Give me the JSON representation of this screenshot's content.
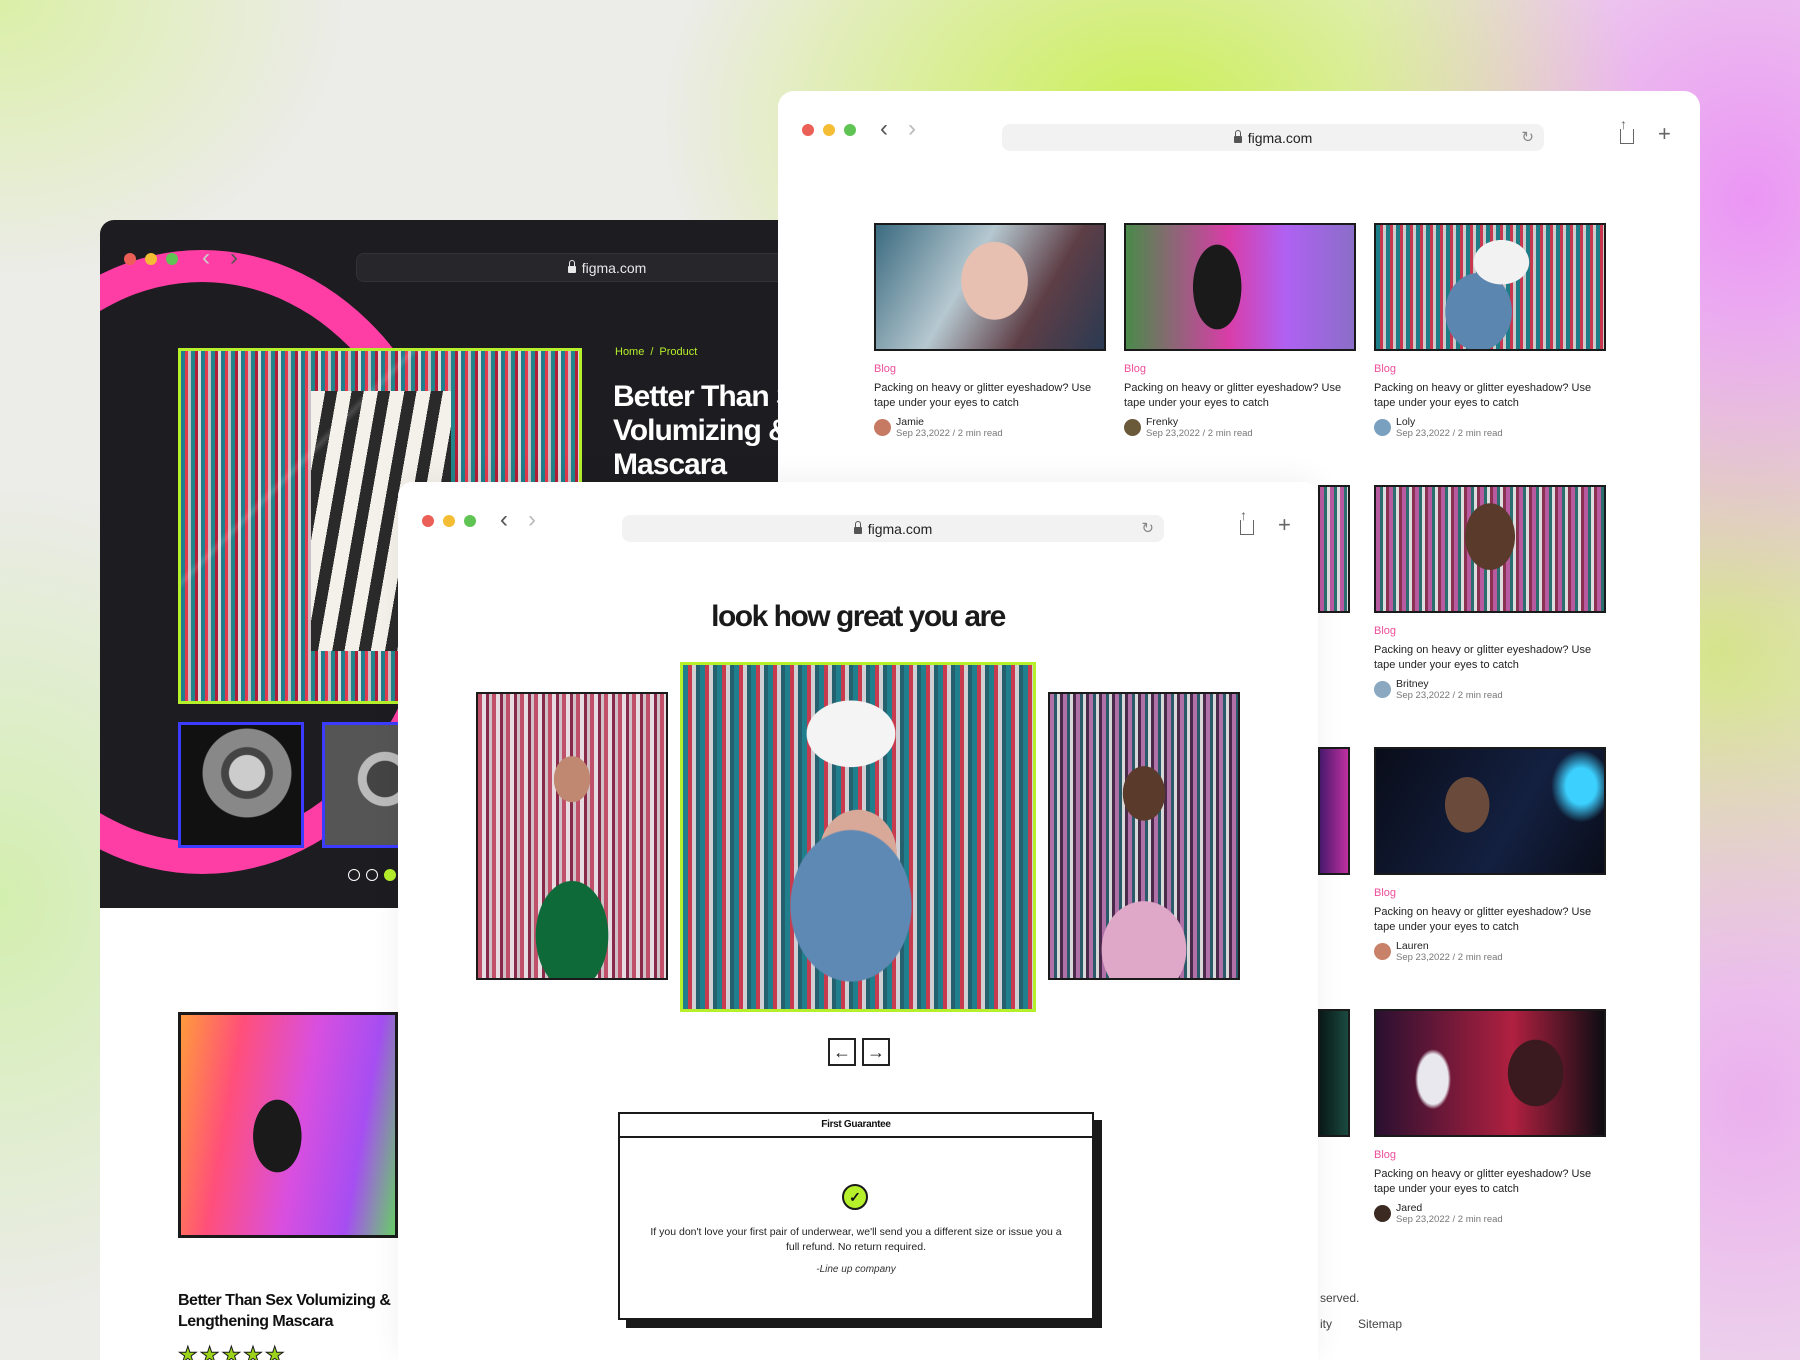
{
  "colors": {
    "accent_lime": "#b6f02b",
    "accent_pink": "#ff3ea5",
    "blog_tag": "#ec4f9a",
    "dark_bg": "#1d1d21"
  },
  "windows": {
    "product": {
      "url": "figma.com",
      "breadcrumb": {
        "home": "Home",
        "sep": "/",
        "current": "Product"
      },
      "title": "Better Than Sex Volumizing & Mascara",
      "second_title": "Better Than Sex Volumizing & Lengthening Mascara",
      "stars": "★★★★★"
    },
    "blog": {
      "url": "figma.com",
      "cards": [
        {
          "tag": "Blog",
          "title": "Packing on heavy or glitter eyeshadow? Use tape under your eyes to catch",
          "author": "Jamie",
          "date": "Sep 23,2022  /  2 min read"
        },
        {
          "tag": "Blog",
          "title": "Packing on heavy or glitter eyeshadow? Use tape under your eyes to catch",
          "author": "Frenky",
          "date": "Sep 23,2022  /  2 min read"
        },
        {
          "tag": "Blog",
          "title": "Packing on heavy or glitter eyeshadow? Use tape under your eyes to catch",
          "author": "Loly",
          "date": "Sep 23,2022  /  2 min read"
        },
        {
          "tag": "Blog",
          "title": "Packing on heavy or glitter eyeshadow? Use tape under your eyes to catch",
          "author": "Britney",
          "date": "Sep 23,2022  /  2 min read"
        },
        {
          "tag": "Blog",
          "title": "Packing on heavy or glitter eyeshadow? Use tape under your eyes to catch",
          "author": "Lauren",
          "date": "Sep 23,2022  /  2 min read"
        },
        {
          "tag": "Blog",
          "title": "Packing on heavy or glitter eyeshadow? Use tape under your eyes to catch",
          "author": "Jared",
          "date": "Sep 23,2022  /  2 min read"
        }
      ],
      "footer": {
        "rights": "served.",
        "link1": "ity",
        "sitemap": "Sitemap"
      }
    },
    "gallery": {
      "url": "figma.com",
      "heading": "look how great you are",
      "prev_icon": "←",
      "next_icon": "→",
      "guarantee": {
        "title": "First Guarantee",
        "check": "✓",
        "text": "If you don't love your first pair of underwear, we'll send you a different size or issue you a full refund. No return required.",
        "signature": "-Line up company"
      }
    }
  }
}
